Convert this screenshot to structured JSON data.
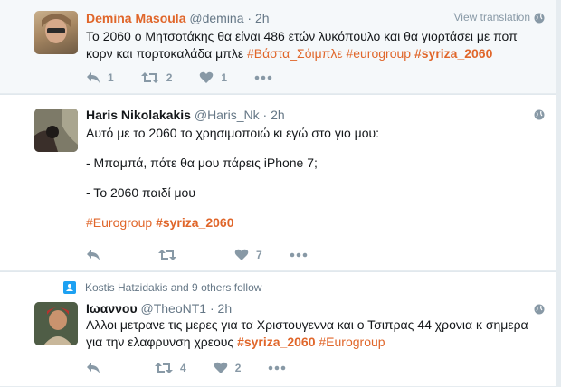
{
  "tweets": [
    {
      "name": "Demina Masoula",
      "handle": "@demina",
      "dot": "·",
      "time": "2h",
      "view_translation": "View translation",
      "text_lines": [
        "Το 2060 ο Μητσοτάκης θα είναι 486 ετών λυκόπουλο και θα γιορτάσει με ποπ",
        "κορν και πορτοκαλάδα μπλε"
      ],
      "hashtags": [
        "#Βάστα_Σόιμπλε",
        "#eurogroup",
        "#syriza_2060"
      ],
      "replies": "1",
      "retweets": "2",
      "likes": "1"
    },
    {
      "name": "Haris Nikolakakis",
      "handle": "@Haris_Nk",
      "dot": "·",
      "time": "2h",
      "lines": [
        "Αυτό με το 2060 το χρησιμοποιώ κι εγώ στο γιο μου:",
        "- Μπαμπά, πότε θα μου πάρεις iPhone 7;",
        "- Το 2060 παιδί μου"
      ],
      "hashtags": [
        "#Eurogroup",
        "#syriza_2060"
      ],
      "replies": "",
      "retweets": "",
      "likes": "7"
    },
    {
      "context": "Kostis Hatzidakis and 9 others follow",
      "name": "Ιωαννου",
      "handle": "@TheoNT1",
      "dot": "·",
      "time": "2h",
      "text_lines": [
        "Αλλοι μετρανε τις μερες για τα Χριστουγεννα και ο Τσιπρας 44 χρονια κ σημερα",
        "για την ελαφρυνση χρεους"
      ],
      "hashtags": [
        "#syriza_2060",
        "#Eurogroup"
      ],
      "replies": "",
      "retweets": "4",
      "likes": "2"
    }
  ],
  "icons": {
    "reply": "reply-icon",
    "retweet": "retweet-icon",
    "like": "heart-icon",
    "more": "more-icon",
    "globe": "globe-icon",
    "follow": "follow-context-icon"
  },
  "colors": {
    "hashtag": "#e0662a",
    "muted": "#8899a6",
    "background": "#e6ecf0",
    "highlight": "#f5f8fa"
  }
}
